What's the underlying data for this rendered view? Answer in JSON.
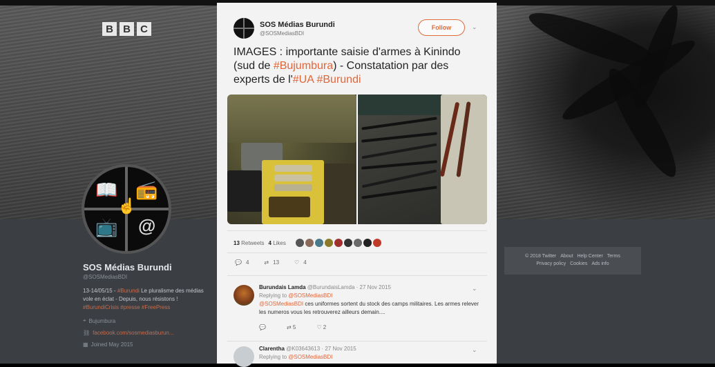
{
  "brand": {
    "letters": [
      "B",
      "B",
      "C"
    ]
  },
  "profile": {
    "name": "SOS Médias Burundi",
    "handle": "@SOSMediasBDI",
    "bio_prefix": "13-14/05/15 - ",
    "bio_tag1": "#Burundi",
    "bio_mid": " Le pluralisme des médias vole en éclat - Depuis, nous résistons ! ",
    "bio_tags": "#BurundiCrisis #presse #FreePress",
    "location": "Bujumbura",
    "website": "facebook.com/sosmediasburun...",
    "joined": "Joined May 2015"
  },
  "footer": {
    "row1": [
      "© 2018 Twitter",
      "About",
      "Help Center",
      "Terms"
    ],
    "row2": [
      "Privacy policy",
      "Cookies",
      "Ads info"
    ]
  },
  "tweet": {
    "account_name": "SOS Médias Burundi",
    "account_handle": "@SOSMediasBDI",
    "follow_label": "Follow",
    "text_1": "IMAGES : importante saisie d'armes à Kinindo (sud de ",
    "tag_bujumbura": "#Bujumbura",
    "text_2": ") - Constatation par des experts de l'",
    "tag_ua": "#UA",
    "tag_burundi": "#Burundi",
    "retweets": "13",
    "retweets_label": "Retweets",
    "likes": "4",
    "likes_label": "Likes",
    "liker_colors": [
      "#555",
      "#8a6a5a",
      "#4a7a8a",
      "#8a7a2a",
      "#a03030",
      "#333",
      "#6a6a6a",
      "#222",
      "#c03a2a"
    ],
    "replies_count": "4",
    "retweet_count": "13",
    "like_count": "4"
  },
  "replies": [
    {
      "name": "Burundais Lamda",
      "handle": "@BurundaisLamda",
      "date": "· 27 Nov 2015",
      "replying_to_label": "Replying to ",
      "replying_to": "@SOSMediasBDI",
      "mention": "@SOSMediasBDI",
      "text": " ces uniformes sortent du stock des camps militaires. Les armes relever les numeros vous les retrouverez ailleurs demain....",
      "retweets": "5",
      "likes": "2",
      "avatar_color": "#7a3a1a"
    },
    {
      "name": "Clarentha",
      "handle": "@K03643613",
      "date": "· 27 Nov 2015",
      "replying_to_label": "Replying to ",
      "replying_to": "@SOSMediasBDI",
      "avatar_color": "#c8cdd2"
    }
  ]
}
